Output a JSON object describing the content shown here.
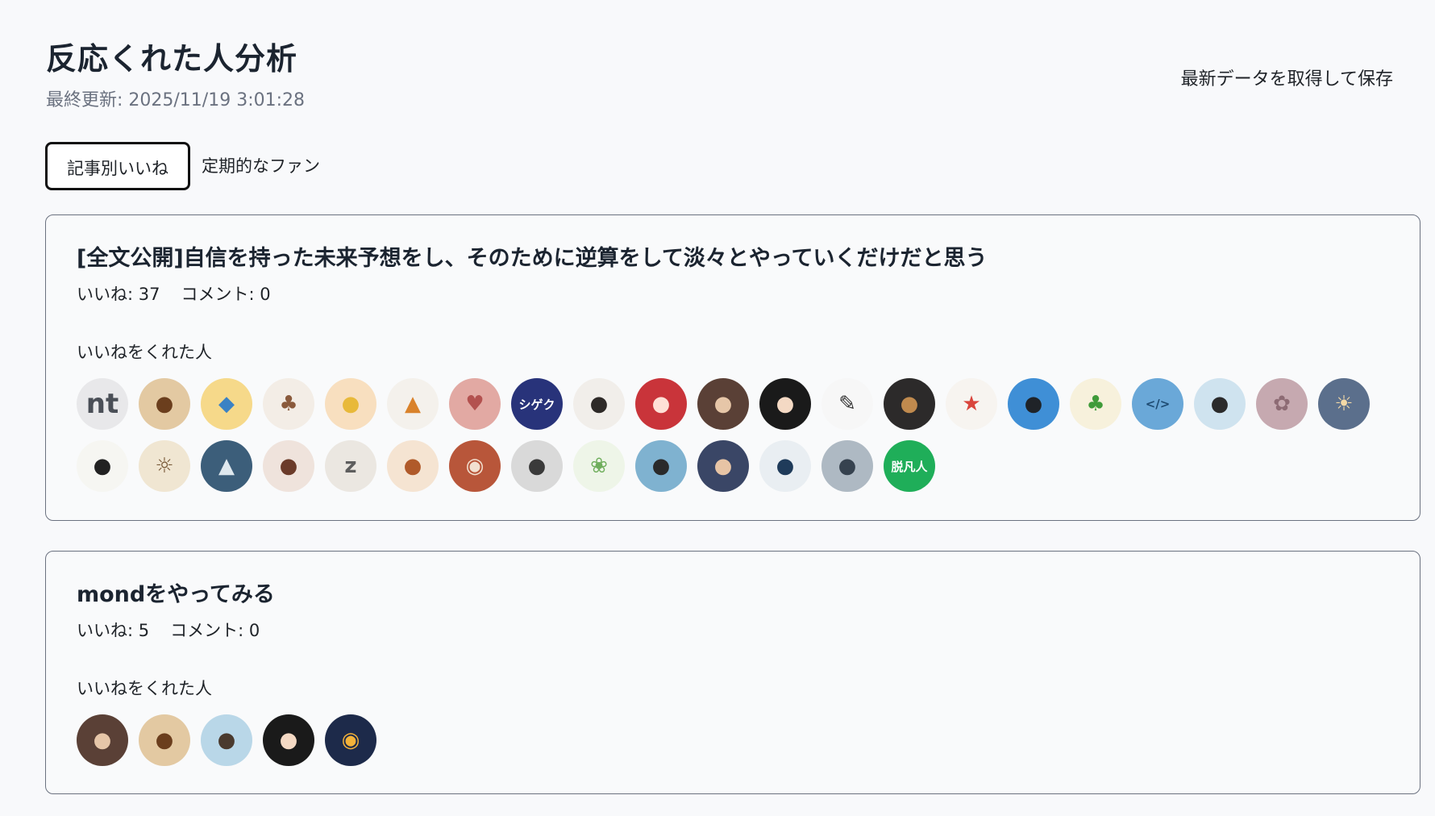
{
  "header": {
    "title": "反応くれた人分析",
    "last_updated": "最終更新: 2025/11/19 3:01:28",
    "refresh_label": "最新データを取得して保存"
  },
  "tabs": [
    {
      "label": "記事別いいね",
      "active": true
    },
    {
      "label": "定期的なファン",
      "active": false
    }
  ],
  "articles": [
    {
      "title": "[全文公開]自信を持った未来予想をし、そのために逆算をして淡々とやっていくだけだと思う",
      "likes": "いいね: 37",
      "comments": "コメント: 0",
      "likers_label": "いいねをくれた人",
      "likers": [
        {
          "icon": "note-logo-avatar",
          "bg": "#e8e8ea",
          "fg": "#4a4f57",
          "glyph": "nt"
        },
        {
          "icon": "illustrated-woman-avatar",
          "bg": "#e3c9a2",
          "fg": "#6b3e1d",
          "glyph": "●"
        },
        {
          "icon": "blue-bird-avatar",
          "bg": "#f6d98a",
          "fg": "#3b82c4",
          "glyph": "◆"
        },
        {
          "icon": "squirrel-avatar",
          "bg": "#f3ede6",
          "fg": "#8a5a3c",
          "glyph": "♣"
        },
        {
          "icon": "yellow-chick-avatar",
          "bg": "#f8dfbf",
          "fg": "#e8b93a",
          "glyph": "●"
        },
        {
          "icon": "fox-businessman-avatar",
          "bg": "#f4f1ec",
          "fg": "#d9822b",
          "glyph": "▲"
        },
        {
          "icon": "pink-girl-avatar",
          "bg": "#e2a9a3",
          "fg": "#b3514f",
          "glyph": "♥"
        },
        {
          "icon": "shigeku-logo-avatar",
          "bg": "#28337a",
          "fg": "#ffffff",
          "glyph": "シゲク"
        },
        {
          "icon": "woman-photo-avatar",
          "bg": "#f1eeea",
          "fg": "#2e2a28",
          "glyph": "●"
        },
        {
          "icon": "red-hair-girl-avatar",
          "bg": "#c9343a",
          "fg": "#ffe0d6",
          "glyph": "●"
        },
        {
          "icon": "woman-dark-photo-avatar",
          "bg": "#5a4036",
          "fg": "#e6c6a8",
          "glyph": "●"
        },
        {
          "icon": "black-hair-girl-avatar",
          "bg": "#1a1a1a",
          "fg": "#f4d9c4",
          "glyph": "●"
        },
        {
          "icon": "sketch-man-avatar",
          "bg": "#f7f7f7",
          "fg": "#333333",
          "glyph": "✎"
        },
        {
          "icon": "bear-headphones-avatar",
          "bg": "#2c2a2a",
          "fg": "#c08a4e",
          "glyph": "●"
        },
        {
          "icon": "cartoon-character-avatar",
          "bg": "#f7f4f0",
          "fg": "#d9453c",
          "glyph": "★"
        },
        {
          "icon": "sky-boy-avatar",
          "bg": "#3f8fd6",
          "fg": "#1f2328",
          "glyph": "●"
        },
        {
          "icon": "clover-avatar",
          "bg": "#f7f1dc",
          "fg": "#3f9b3a",
          "glyph": "♣"
        },
        {
          "icon": "code-laptop-avatar",
          "bg": "#6aa8d8",
          "fg": "#1e4b72",
          "glyph": "</>"
        },
        {
          "icon": "glasses-man-avatar",
          "bg": "#cfe3ef",
          "fg": "#2b2b2b",
          "glyph": "●"
        },
        {
          "icon": "pink-blur-avatar",
          "bg": "#c6a9b0",
          "fg": "#8d6b74",
          "glyph": "✿"
        },
        {
          "icon": "sunset-sea-avatar",
          "bg": "#5b6f8c",
          "fg": "#f3d9a6",
          "glyph": "☀"
        },
        {
          "icon": "white-bird-avatar",
          "bg": "#f6f6f2",
          "fg": "#222222",
          "glyph": "●"
        },
        {
          "icon": "old-man-lightbulb-avatar",
          "bg": "#f0e6d2",
          "fg": "#7a5b3a",
          "glyph": "☼"
        },
        {
          "icon": "mountain-avatar",
          "bg": "#3c5e7a",
          "fg": "#dfe8ee",
          "glyph": "▲"
        },
        {
          "icon": "anime-girl-bow-avatar",
          "bg": "#efe3dc",
          "fg": "#6b3b2a",
          "glyph": "●"
        },
        {
          "icon": "sleeping-man-avatar",
          "bg": "#ebe7e1",
          "fg": "#5e5e5e",
          "glyph": "z"
        },
        {
          "icon": "brown-hair-girl-avatar",
          "bg": "#f5e4d2",
          "fg": "#b05a2a",
          "glyph": "●"
        },
        {
          "icon": "robot-avatar",
          "bg": "#b8563a",
          "fg": "#f2e0d0",
          "glyph": "◉"
        },
        {
          "icon": "gray-hair-character-avatar",
          "bg": "#d9d9d9",
          "fg": "#3a3a3a",
          "glyph": "●"
        },
        {
          "icon": "green-wreath-girl-avatar",
          "bg": "#eef5e8",
          "fg": "#6fae5c",
          "glyph": "❀"
        },
        {
          "icon": "man-with-books-avatar",
          "bg": "#7fb2d0",
          "fg": "#2a2a2a",
          "glyph": "●"
        },
        {
          "icon": "man-portrait-avatar",
          "bg": "#3a4666",
          "fg": "#e7c4a5",
          "glyph": "●"
        },
        {
          "icon": "man-with-laptop-avatar",
          "bg": "#e9eef2",
          "fg": "#1f3b5a",
          "glyph": "●"
        },
        {
          "icon": "man-city-avatar",
          "bg": "#aeb9c3",
          "fg": "#36424f",
          "glyph": "●"
        },
        {
          "icon": "datsubonjin-marketing-avatar",
          "bg": "#1fae59",
          "fg": "#ffffff",
          "glyph": "脱凡人"
        }
      ]
    },
    {
      "title": "mondをやってみる",
      "likes": "いいね: 5",
      "comments": "コメント: 0",
      "likers_label": "いいねをくれた人",
      "likers": [
        {
          "icon": "woman-dark-photo-avatar",
          "bg": "#5a4036",
          "fg": "#e6c6a8",
          "glyph": "●"
        },
        {
          "icon": "illustrated-woman-avatar",
          "bg": "#e3c9a2",
          "fg": "#6b3e1d",
          "glyph": "●"
        },
        {
          "icon": "laptop-boy-avatar",
          "bg": "#b9d7e8",
          "fg": "#4a3a2e",
          "glyph": "●"
        },
        {
          "icon": "black-hair-girl-avatar",
          "bg": "#1a1a1a",
          "fg": "#f4d9c4",
          "glyph": "●"
        },
        {
          "icon": "food-bowl-avatar",
          "bg": "#1d2a4a",
          "fg": "#f3b23a",
          "glyph": "◉"
        }
      ]
    }
  ]
}
